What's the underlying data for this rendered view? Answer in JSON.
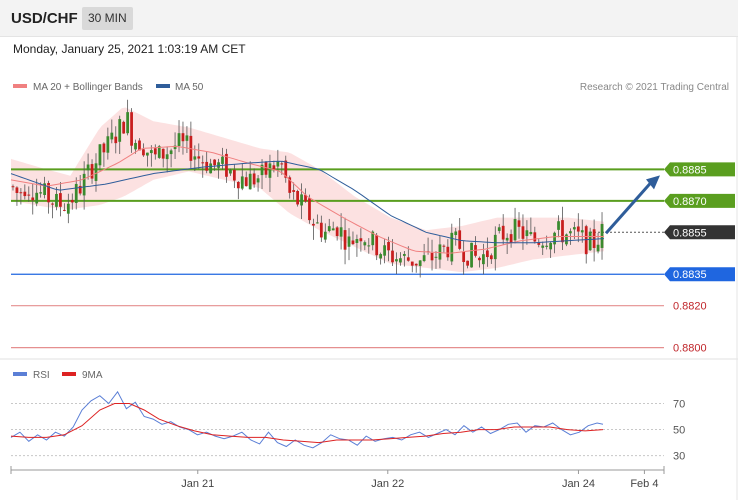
{
  "header": {
    "symbol": "USD/CHF",
    "timeframe": "30 MIN",
    "timestamp": "Monday, January 25, 2021 1:03:19 AM CET"
  },
  "colors": {
    "ma20": "#f08080",
    "ma50": "#2f5d9a",
    "resistance": "#5a9e1f",
    "current": "#333333",
    "support": "#1f66e0",
    "weak_support": "#d44",
    "rsi": "#5b7fd6",
    "rsi_ma": "#d22"
  },
  "chart_data": [
    {
      "type": "candlestick",
      "legend": [
        {
          "label": "MA 20 + Bollinger Bands",
          "color": "#f08080"
        },
        {
          "label": "MA 50",
          "color": "#2f5d9a"
        }
      ],
      "credit": "Research © 2021 Trading Central",
      "ylim": [
        0.8796,
        0.892
      ],
      "levels": [
        {
          "label": "0.8885",
          "value": 0.8885,
          "kind": "resistance"
        },
        {
          "label": "0.8870",
          "value": 0.887,
          "kind": "resistance"
        },
        {
          "label": "0.8855",
          "value": 0.8855,
          "kind": "current"
        },
        {
          "label": "0.8835",
          "value": 0.8835,
          "kind": "support"
        },
        {
          "label": "0.8820",
          "value": 0.882,
          "kind": "weak"
        },
        {
          "label": "0.8800",
          "value": 0.88,
          "kind": "weak"
        }
      ],
      "close_path": [
        [
          0.0,
          0.8877
        ],
        [
          0.012,
          0.8873
        ],
        [
          0.025,
          0.8878
        ],
        [
          0.04,
          0.8875
        ],
        [
          0.06,
          0.8872
        ],
        [
          0.08,
          0.8868
        ],
        [
          0.1,
          0.887
        ],
        [
          0.12,
          0.8878
        ],
        [
          0.14,
          0.8888
        ],
        [
          0.16,
          0.8895
        ],
        [
          0.18,
          0.8903
        ],
        [
          0.195,
          0.891
        ],
        [
          0.205,
          0.89
        ],
        [
          0.22,
          0.8898
        ],
        [
          0.24,
          0.889
        ],
        [
          0.26,
          0.8893
        ],
        [
          0.28,
          0.8897
        ],
        [
          0.3,
          0.8895
        ],
        [
          0.32,
          0.889
        ],
        [
          0.34,
          0.8887
        ],
        [
          0.36,
          0.8886
        ],
        [
          0.38,
          0.8882
        ],
        [
          0.4,
          0.888
        ],
        [
          0.42,
          0.8881
        ],
        [
          0.44,
          0.8886
        ],
        [
          0.455,
          0.8888
        ],
        [
          0.47,
          0.8873
        ],
        [
          0.49,
          0.8868
        ],
        [
          0.51,
          0.886
        ],
        [
          0.53,
          0.8855
        ],
        [
          0.55,
          0.8858
        ],
        [
          0.57,
          0.885
        ],
        [
          0.59,
          0.8855
        ],
        [
          0.61,
          0.885
        ],
        [
          0.63,
          0.8845
        ],
        [
          0.65,
          0.8843
        ],
        [
          0.67,
          0.8842
        ],
        [
          0.69,
          0.8841
        ],
        [
          0.71,
          0.8843
        ],
        [
          0.73,
          0.8847
        ],
        [
          0.75,
          0.885
        ],
        [
          0.77,
          0.8845
        ],
        [
          0.79,
          0.8842
        ],
        [
          0.805,
          0.8846
        ],
        [
          0.82,
          0.8852
        ],
        [
          0.84,
          0.8856
        ],
        [
          0.86,
          0.8855
        ],
        [
          0.88,
          0.8851
        ],
        [
          0.9,
          0.8853
        ],
        [
          0.92,
          0.8855
        ],
        [
          0.94,
          0.8854
        ],
        [
          0.96,
          0.8852
        ],
        [
          0.98,
          0.8849
        ],
        [
          1.0,
          0.8856
        ]
      ],
      "ma20_path": [
        [
          0.0,
          0.888
        ],
        [
          0.06,
          0.8877
        ],
        [
          0.12,
          0.888
        ],
        [
          0.18,
          0.8888
        ],
        [
          0.22,
          0.8895
        ],
        [
          0.28,
          0.8896
        ],
        [
          0.34,
          0.8893
        ],
        [
          0.4,
          0.8888
        ],
        [
          0.455,
          0.8884
        ],
        [
          0.5,
          0.8872
        ],
        [
          0.56,
          0.8862
        ],
        [
          0.62,
          0.8853
        ],
        [
          0.68,
          0.8846
        ],
        [
          0.74,
          0.8845
        ],
        [
          0.8,
          0.8847
        ],
        [
          0.86,
          0.8851
        ],
        [
          0.92,
          0.8853
        ],
        [
          1.0,
          0.8853
        ]
      ],
      "band_upper_path": [
        [
          0.0,
          0.889
        ],
        [
          0.06,
          0.8885
        ],
        [
          0.1,
          0.8882
        ],
        [
          0.15,
          0.8905
        ],
        [
          0.19,
          0.8915
        ],
        [
          0.24,
          0.8908
        ],
        [
          0.3,
          0.8905
        ],
        [
          0.36,
          0.89
        ],
        [
          0.42,
          0.8895
        ],
        [
          0.47,
          0.8893
        ],
        [
          0.52,
          0.8885
        ],
        [
          0.58,
          0.8872
        ],
        [
          0.64,
          0.8862
        ],
        [
          0.7,
          0.8856
        ],
        [
          0.76,
          0.8858
        ],
        [
          0.82,
          0.8862
        ],
        [
          0.88,
          0.8862
        ],
        [
          0.94,
          0.8862
        ],
        [
          1.0,
          0.886
        ]
      ],
      "band_lower_path": [
        [
          0.0,
          0.887
        ],
        [
          0.06,
          0.8867
        ],
        [
          0.1,
          0.8866
        ],
        [
          0.15,
          0.8868
        ],
        [
          0.19,
          0.8872
        ],
        [
          0.24,
          0.888
        ],
        [
          0.3,
          0.8884
        ],
        [
          0.36,
          0.888
        ],
        [
          0.42,
          0.8876
        ],
        [
          0.47,
          0.8864
        ],
        [
          0.52,
          0.8856
        ],
        [
          0.58,
          0.8848
        ],
        [
          0.64,
          0.884
        ],
        [
          0.7,
          0.8838
        ],
        [
          0.76,
          0.8836
        ],
        [
          0.82,
          0.8838
        ],
        [
          0.88,
          0.8842
        ],
        [
          0.94,
          0.8844
        ],
        [
          1.0,
          0.8846
        ]
      ],
      "ma50_path": [
        [
          0.0,
          0.8883
        ],
        [
          0.08,
          0.8875
        ],
        [
          0.16,
          0.8878
        ],
        [
          0.24,
          0.8883
        ],
        [
          0.32,
          0.8886
        ],
        [
          0.4,
          0.8888
        ],
        [
          0.455,
          0.8889
        ],
        [
          0.52,
          0.8885
        ],
        [
          0.58,
          0.8875
        ],
        [
          0.64,
          0.8863
        ],
        [
          0.7,
          0.8855
        ],
        [
          0.76,
          0.8851
        ],
        [
          0.82,
          0.885
        ],
        [
          0.88,
          0.885
        ],
        [
          0.94,
          0.8851
        ],
        [
          1.0,
          0.8852
        ]
      ],
      "projection": {
        "from": 0.8855,
        "to": 0.8885
      }
    },
    {
      "type": "line",
      "legend": [
        {
          "label": "RSI",
          "color": "#5b7fd6"
        },
        {
          "label": "9MA",
          "color": "#d22"
        }
      ],
      "ylim": [
        22,
        85
      ],
      "y_ticks": [
        "70",
        "50",
        "30"
      ],
      "y_tick_values": [
        70,
        50,
        30
      ],
      "x_ticks": [
        {
          "label": "Jan 21",
          "pos": 0.286
        },
        {
          "label": "Jan 22",
          "pos": 0.577
        },
        {
          "label": "Jan 24",
          "pos": 0.869
        },
        {
          "label": "Feb 4",
          "pos": 0.97
        }
      ],
      "series": [
        {
          "name": "RSI",
          "points": [
            [
              0.0,
              44
            ],
            [
              0.015,
              48
            ],
            [
              0.03,
              41
            ],
            [
              0.045,
              46
            ],
            [
              0.06,
              42
            ],
            [
              0.075,
              48
            ],
            [
              0.09,
              45
            ],
            [
              0.105,
              52
            ],
            [
              0.12,
              65
            ],
            [
              0.135,
              72
            ],
            [
              0.15,
              76
            ],
            [
              0.165,
              70
            ],
            [
              0.18,
              79
            ],
            [
              0.195,
              66
            ],
            [
              0.21,
              71
            ],
            [
              0.225,
              60
            ],
            [
              0.24,
              58
            ],
            [
              0.255,
              54
            ],
            [
              0.27,
              56
            ],
            [
              0.285,
              52
            ],
            [
              0.3,
              50
            ],
            [
              0.315,
              46
            ],
            [
              0.33,
              48
            ],
            [
              0.345,
              45
            ],
            [
              0.36,
              43
            ],
            [
              0.375,
              45
            ],
            [
              0.39,
              48
            ],
            [
              0.405,
              42
            ],
            [
              0.42,
              39
            ],
            [
              0.435,
              48
            ],
            [
              0.45,
              40
            ],
            [
              0.465,
              37
            ],
            [
              0.48,
              42
            ],
            [
              0.495,
              38
            ],
            [
              0.51,
              36
            ],
            [
              0.525,
              40
            ],
            [
              0.54,
              46
            ],
            [
              0.555,
              43
            ],
            [
              0.57,
              42
            ],
            [
              0.585,
              38
            ],
            [
              0.6,
              45
            ],
            [
              0.615,
              41
            ],
            [
              0.63,
              43
            ],
            [
              0.645,
              44
            ],
            [
              0.66,
              42
            ],
            [
              0.675,
              46
            ],
            [
              0.69,
              48
            ],
            [
              0.705,
              44
            ],
            [
              0.72,
              47
            ],
            [
              0.735,
              50
            ],
            [
              0.75,
              46
            ],
            [
              0.765,
              53
            ],
            [
              0.78,
              48
            ],
            [
              0.795,
              52
            ],
            [
              0.81,
              47
            ],
            [
              0.825,
              50
            ],
            [
              0.84,
              54
            ],
            [
              0.855,
              55
            ],
            [
              0.87,
              48
            ],
            [
              0.885,
              53
            ],
            [
              0.9,
              52
            ],
            [
              0.915,
              55
            ],
            [
              0.93,
              50
            ],
            [
              0.945,
              46
            ],
            [
              0.96,
              48
            ],
            [
              0.975,
              53
            ],
            [
              0.99,
              55
            ],
            [
              1.0,
              54
            ]
          ]
        },
        {
          "name": "9MA",
          "points": [
            [
              0.0,
              45
            ],
            [
              0.03,
              44
            ],
            [
              0.06,
              44
            ],
            [
              0.09,
              46
            ],
            [
              0.12,
              53
            ],
            [
              0.15,
              65
            ],
            [
              0.175,
              70
            ],
            [
              0.2,
              70
            ],
            [
              0.225,
              65
            ],
            [
              0.25,
              58
            ],
            [
              0.28,
              53
            ],
            [
              0.31,
              49
            ],
            [
              0.34,
              46
            ],
            [
              0.37,
              45
            ],
            [
              0.4,
              44
            ],
            [
              0.43,
              44
            ],
            [
              0.46,
              42
            ],
            [
              0.49,
              41
            ],
            [
              0.52,
              40
            ],
            [
              0.55,
              42
            ],
            [
              0.58,
              42
            ],
            [
              0.61,
              42
            ],
            [
              0.64,
              43
            ],
            [
              0.67,
              44
            ],
            [
              0.7,
              45
            ],
            [
              0.73,
              47
            ],
            [
              0.76,
              48
            ],
            [
              0.79,
              50
            ],
            [
              0.82,
              50
            ],
            [
              0.85,
              52
            ],
            [
              0.88,
              52
            ],
            [
              0.91,
              52
            ],
            [
              0.94,
              50
            ],
            [
              0.97,
              49
            ],
            [
              1.0,
              50
            ]
          ]
        }
      ]
    }
  ]
}
